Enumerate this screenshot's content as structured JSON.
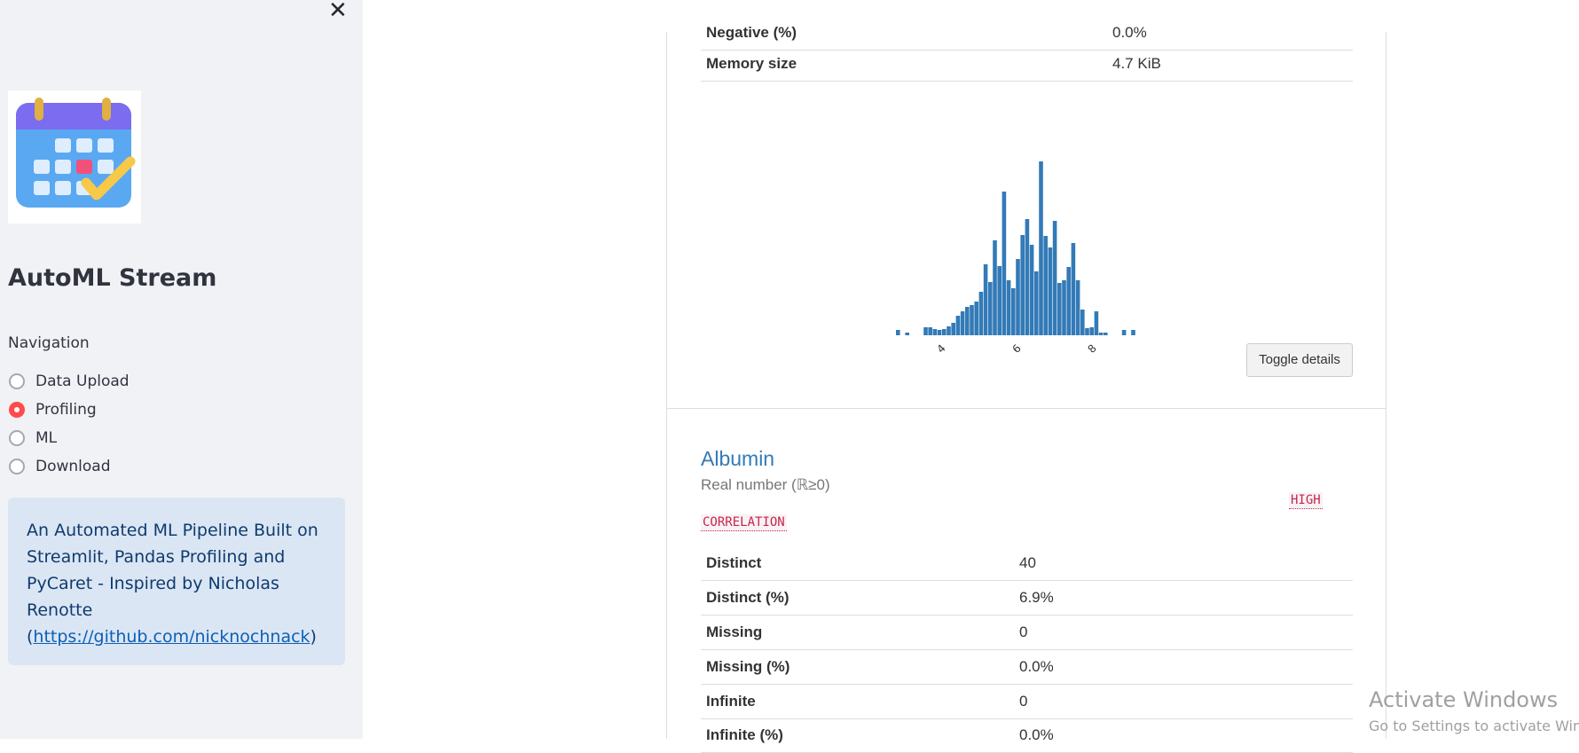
{
  "sidebar": {
    "close_icon": "close-icon",
    "app_title": "AutoML Stream",
    "nav_label": "Navigation",
    "nav_items": [
      {
        "label": "Data Upload",
        "selected": false
      },
      {
        "label": "Profiling",
        "selected": true
      },
      {
        "label": "ML",
        "selected": false
      },
      {
        "label": "Download",
        "selected": false
      }
    ],
    "info": {
      "text": "An Automated ML Pipeline Built on Streamlit, Pandas Profiling and PyCaret - Inspired by Nicholas Renotte (",
      "link": "https://github.com/nicknochnack",
      "suffix": ")"
    },
    "accent_color": "#ff4b4b"
  },
  "report": {
    "top_rows": [
      {
        "key": "Negative (%)",
        "value": "0.0%"
      },
      {
        "key": "Memory size",
        "value": "4.7 KiB"
      }
    ],
    "histogram": {
      "tick_labels": [
        "4",
        "6",
        "8"
      ],
      "bar_color": "#337ab7"
    },
    "toggle_label": "Toggle details",
    "variable": {
      "name": "Albumin",
      "type_text": "Real number (ℝ≥0)",
      "alerts": [
        "HIGH",
        "CORRELATION"
      ]
    },
    "bottom_rows": [
      {
        "key": "Distinct",
        "value": "40"
      },
      {
        "key": "Distinct (%)",
        "value": "6.9%"
      },
      {
        "key": "Missing",
        "value": "0"
      },
      {
        "key": "Missing (%)",
        "value": "0.0%"
      },
      {
        "key": "Infinite",
        "value": "0"
      },
      {
        "key": "Infinite (%)",
        "value": "0.0%"
      }
    ]
  },
  "watermark": {
    "line1": "Activate Windows",
    "line2": "Go to Settings to activate Windows."
  }
}
